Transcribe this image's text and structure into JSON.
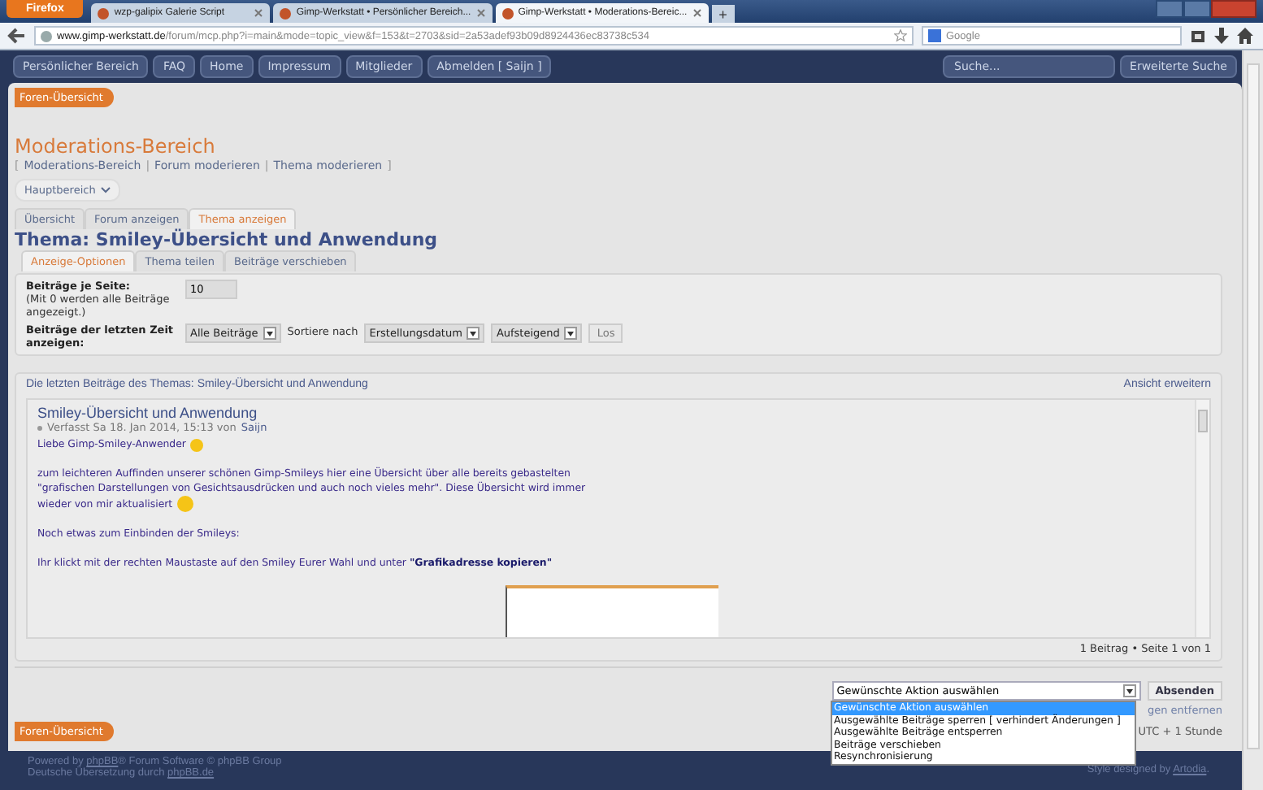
{
  "browser": {
    "app_button": "Firefox",
    "tabs": [
      {
        "title": "wzp-galipix Galerie Script",
        "selected": false
      },
      {
        "title": "Gimp-Werkstatt • Persönlicher Bereich...",
        "selected": false
      },
      {
        "title": "Gimp-Werkstatt • Moderations-Bereic...",
        "selected": true
      }
    ],
    "new_tab": "+",
    "url_domain": "www.gimp-werkstatt.de",
    "url_path": "/forum/mcp.php?i=main&mode=topic_view&f=153&t=2703&sid=2a53adef93b09d8924436ec83738c534",
    "search_placeholder": "Google"
  },
  "nav": {
    "items": [
      "Persönlicher Bereich",
      "FAQ",
      "Home",
      "Impressum",
      "Mitglieder",
      "Abmelden [ Saijn ]"
    ],
    "search_placeholder": "Suche...",
    "advanced_search": "Erweiterte Suche"
  },
  "forum_index": "Foren-Übersicht",
  "title": "Moderations-Bereich",
  "breadcrumbs": [
    {
      "kind": "bracket",
      "text": "["
    },
    {
      "kind": "link",
      "text": "Moderations-Bereich"
    },
    {
      "kind": "separator",
      "text": "|"
    },
    {
      "kind": "link",
      "text": "Forum moderieren"
    },
    {
      "kind": "separator",
      "text": "|"
    },
    {
      "kind": "link",
      "text": "Thema moderieren"
    },
    {
      "kind": "bracket",
      "text": "]"
    }
  ],
  "section_dropdown": "Hauptbereich",
  "tabs": [
    {
      "label": "Übersicht",
      "selected": false
    },
    {
      "label": "Forum anzeigen",
      "selected": false
    },
    {
      "label": "Thema anzeigen",
      "selected": true
    }
  ],
  "topic_title": "Thema: Smiley-Übersicht und Anwendung",
  "subtabs": [
    {
      "label": "Anzeige-Optionen",
      "selected": true
    },
    {
      "label": "Thema teilen",
      "selected": false
    },
    {
      "label": "Beiträge verschieben",
      "selected": false
    }
  ],
  "options": {
    "per_page_label": "Beiträge je Seite:",
    "per_page_hint": "(Mit 0 werden alle Beiträge angezeigt.)",
    "per_page_value": "10",
    "period_label": "Beiträge der letzten Zeit anzeigen:",
    "period_value": "Alle Beiträge",
    "sort_label": "Sortiere nach",
    "sort_value": "Erstellungsdatum",
    "order_value": "Aufsteigend",
    "go": "Los"
  },
  "posts": {
    "heading": "Die letzten Beiträge des Themas: Smiley-Übersicht und Anwendung",
    "expand": "Ansicht erweitern",
    "post": {
      "title": "Smiley-Übersicht und Anwendung",
      "meta": "Verfasst Sa 18. Jan 2014, 15:13 von",
      "author": "Saijn",
      "greeting": "Liebe Gimp-Smiley-Anwender",
      "paragraph": "zum leichteren Auffinden unserer schönen Gimp-Smileys hier eine Übersicht über alle bereits gebastelten \"grafischen Darstellungen von Gesichtsausdrücken und auch noch vieles mehr\". Diese Übersicht wird immer",
      "paragraph_end": "wieder von mir aktualisiert",
      "line2": "Noch etwas zum Einbinden der Smileys:",
      "line3": "Ihr klickt mit der rechten Maustaste auf den Smiley Eurer Wahl und unter **\"Grafikadresse kopieren\"**"
    },
    "pagination": "1 Beitrag • Seite 1 von 1"
  },
  "actions": {
    "select_value": "Gewünschte Aktion auswählen",
    "submit": "Absenden",
    "behind_link": "gen entfernen",
    "timezone": "UTC + 1 Stunde",
    "options": [
      {
        "label": "Gewünschte Aktion auswählen",
        "selected": true
      },
      {
        "label": "Ausgewählte Beiträge sperren [ verhindert Änderungen ]",
        "selected": false
      },
      {
        "label": "Ausgewählte Beiträge entsperren",
        "selected": false
      },
      {
        "label": "Beiträge verschieben",
        "selected": false
      },
      {
        "label": "Resynchronisierung",
        "selected": false
      }
    ]
  },
  "forum_index_bottom": "Foren-Übersicht",
  "footer": {
    "powered": "Powered by",
    "phpbb": "phpBB",
    "powered_rest": "® Forum Software © phpBB Group",
    "translation": "Deutsche Übersetzung durch",
    "translation_link": "phpBB.de",
    "style": "Style designed by",
    "style_link": "Artodia",
    "style_end": "."
  }
}
